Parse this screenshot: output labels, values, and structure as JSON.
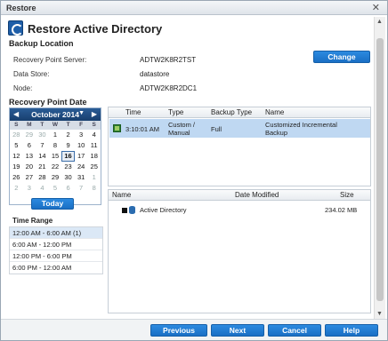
{
  "window": {
    "title": "Restore"
  },
  "header": {
    "title": "Restore Active Directory"
  },
  "backup_location": {
    "label": "Backup Location",
    "fields": [
      {
        "label": "Recovery Point Server:",
        "value": "ADTW2K8R2TST"
      },
      {
        "label": "Data Store:",
        "value": "datastore"
      },
      {
        "label": "Node:",
        "value": "ADTW2K8R2DC1"
      }
    ],
    "change_label": "Change"
  },
  "recovery_point_date": {
    "label": "Recovery Point Date"
  },
  "calendar": {
    "month": "October 2014",
    "weekdays": [
      "S",
      "M",
      "T",
      "W",
      "T",
      "F",
      "S"
    ],
    "days": [
      "28",
      "29",
      "30",
      "1",
      "2",
      "3",
      "4",
      "5",
      "6",
      "7",
      "8",
      "9",
      "10",
      "11",
      "12",
      "13",
      "14",
      "15",
      "16",
      "17",
      "18",
      "19",
      "20",
      "21",
      "22",
      "23",
      "24",
      "25",
      "26",
      "27",
      "28",
      "29",
      "30",
      "31",
      "1",
      "2",
      "3",
      "4",
      "5",
      "6",
      "7",
      "8"
    ],
    "selected_day": "16",
    "today_label": "Today"
  },
  "time_range": {
    "label": "Time Range",
    "items": [
      "12:00 AM - 6:00 AM (1)",
      "6:00 AM - 12:00 PM",
      "12:00 PM - 6:00 PM",
      "6:00 PM - 12:00 AM"
    ]
  },
  "recovery_points": {
    "columns": [
      "Time",
      "Type",
      "Backup Type",
      "Name"
    ],
    "rows": [
      {
        "time": "3:10:01 AM",
        "type_line1": "Custom /",
        "type_line2": "Manual",
        "backup_type": "Full",
        "name_line1": "Customized Incremental",
        "name_line2": "Backup"
      }
    ]
  },
  "contents": {
    "columns": [
      "Name",
      "Date Modified",
      "Size"
    ],
    "rows": [
      {
        "name": "Active Directory",
        "date_modified": "",
        "size": "234.02 MB"
      }
    ]
  },
  "footer": {
    "previous_label": "Previous",
    "next_label": "Next",
    "cancel_label": "Cancel",
    "help_label": "Help"
  }
}
